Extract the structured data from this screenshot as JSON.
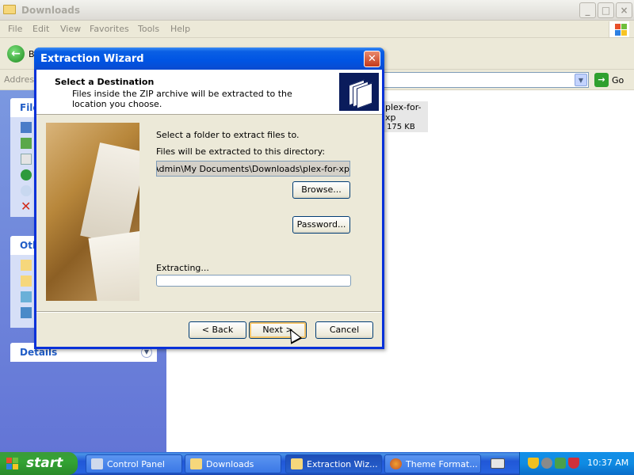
{
  "explorer": {
    "title": "Downloads",
    "menu": [
      "File",
      "Edit",
      "View",
      "Favorites",
      "Tools",
      "Help"
    ],
    "back_label": "B",
    "address_label": "Address",
    "go_label": "Go",
    "panels": {
      "file_tasks_title": "File",
      "other_places_title": "Oth",
      "details_title": "Details"
    },
    "file": {
      "name": "plex-for-xp",
      "size": "175 KB"
    }
  },
  "dialog": {
    "title": "Extraction Wizard",
    "header_title": "Select a Destination",
    "header_subtitle": "Files inside the ZIP archive will be extracted to the location you choose.",
    "select_folder_text": "Select a folder to extract files to.",
    "directory_label": "Files will be extracted to this directory:",
    "path_value": "ings\\Admin\\My Documents\\Downloads\\plex-for-xp",
    "browse_label": "Browse...",
    "password_label": "Password...",
    "extracting_label": "Extracting...",
    "progress": 0,
    "back_label": "< Back",
    "next_label": "Next >",
    "cancel_label": "Cancel"
  },
  "taskbar": {
    "start_label": "start",
    "tasks": [
      "Control Panel",
      "Downloads",
      "Extraction Wiz...",
      "Theme Format..."
    ],
    "clock": "10:37 AM"
  }
}
